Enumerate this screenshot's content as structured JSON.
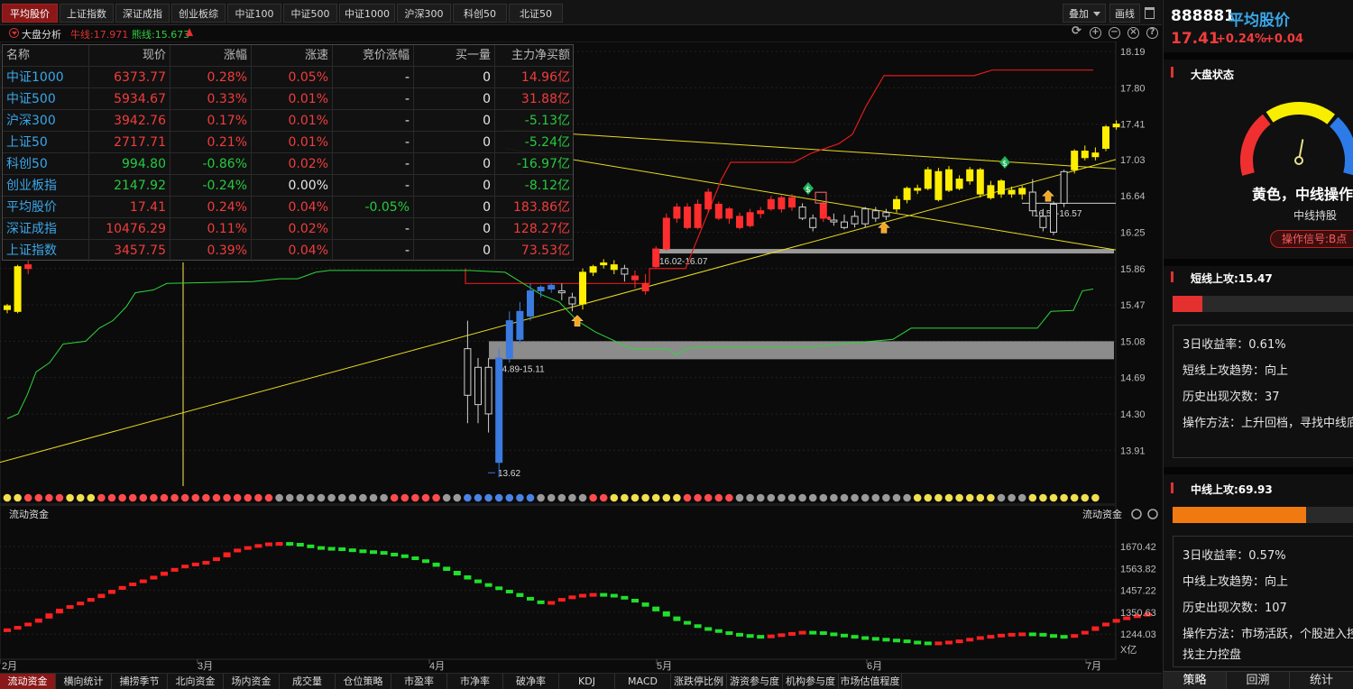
{
  "top_tabs": [
    "平均股价",
    "上证指数",
    "深证成指",
    "创业板综",
    "中证100",
    "中证500",
    "中证1000",
    "沪深300",
    "科创50",
    "北证50"
  ],
  "toolbar": {
    "overlay": "叠加",
    "draw": "画线"
  },
  "subhead": {
    "title": "大盘分析",
    "niu": "牛线:17.971",
    "xiong": "熊线:15.673"
  },
  "main_chart": {
    "y_ticks": [
      "18.19",
      "17.80",
      "17.41",
      "17.03",
      "16.64",
      "16.25",
      "15.86",
      "15.47",
      "15.08",
      "14.69",
      "14.30",
      "13.91"
    ],
    "x_ticks": [
      "2月",
      "3月",
      "4月",
      "5月",
      "6月",
      "7月"
    ],
    "zone_labels": [
      "16.02-16.07",
      "14.89-15.11",
      "16.56-16.57"
    ],
    "low_label": "13.62",
    "colors": {
      "up": "#ff2d2d",
      "down": "#1fe044",
      "yellow": "#ffee00",
      "blue": "#3b7be0",
      "gray": "#cfcfcf"
    }
  },
  "index_table": {
    "headers": [
      "名称",
      "现价",
      "涨幅",
      "涨速",
      "竞价涨幅",
      "买一量",
      "主力净买额"
    ],
    "rows": [
      [
        "中证1000",
        "6373.77",
        "0.28%",
        "0.05%",
        "-",
        "0",
        "14.96亿"
      ],
      [
        "中证500",
        "5934.67",
        "0.33%",
        "0.01%",
        "-",
        "0",
        "31.88亿"
      ],
      [
        "沪深300",
        "3942.76",
        "0.17%",
        "0.01%",
        "-",
        "0",
        "-5.13亿"
      ],
      [
        "上证50",
        "2717.71",
        "0.21%",
        "0.01%",
        "-",
        "0",
        "-5.24亿"
      ],
      [
        "科创50",
        "994.80",
        "-0.86%",
        "0.02%",
        "-",
        "0",
        "-16.97亿"
      ],
      [
        "创业板指",
        "2147.92",
        "-0.24%",
        "0.00%",
        "-",
        "0",
        "-8.12亿"
      ],
      [
        "平均股价",
        "17.41",
        "0.24%",
        "0.04%",
        "-0.05%",
        "0",
        "183.86亿"
      ],
      [
        "深证成指",
        "10476.29",
        "0.11%",
        "0.02%",
        "-",
        "0",
        "128.27亿"
      ],
      [
        "上证指数",
        "3457.75",
        "0.39%",
        "0.04%",
        "-",
        "0",
        "73.53亿"
      ]
    ],
    "row_colors": [
      [
        "blue",
        "red",
        "red",
        "red",
        "white",
        "white",
        "red"
      ],
      [
        "blue",
        "red",
        "red",
        "red",
        "white",
        "white",
        "red"
      ],
      [
        "blue",
        "red",
        "red",
        "red",
        "white",
        "white",
        "green"
      ],
      [
        "blue",
        "red",
        "red",
        "red",
        "white",
        "white",
        "green"
      ],
      [
        "blue",
        "green",
        "green",
        "red",
        "white",
        "white",
        "green"
      ],
      [
        "blue",
        "green",
        "green",
        "white",
        "white",
        "white",
        "green"
      ],
      [
        "blue",
        "red",
        "red",
        "red",
        "green",
        "white",
        "red"
      ],
      [
        "blue",
        "red",
        "red",
        "red",
        "white",
        "white",
        "red"
      ],
      [
        "blue",
        "red",
        "red",
        "red",
        "white",
        "white",
        "red"
      ]
    ]
  },
  "fund_chart": {
    "title": "流动资金",
    "title_right": "流动资金",
    "y_ticks": [
      "1670.42",
      "1563.82",
      "1457.22",
      "1350.63",
      "1244.03"
    ],
    "unit": "X亿"
  },
  "bottom_tabs": [
    "流动资金",
    "横向统计",
    "捕捞季节",
    "北向资金",
    "场内资金",
    "成交量",
    "仓位策略",
    "市盈率",
    "市净率",
    "破净率",
    "KDJ",
    "MACD",
    "涨跌停比例",
    "游资参与度",
    "机构参与度",
    "市场估值程度"
  ],
  "right_panel": {
    "code": "888881",
    "name": "平均股价",
    "price": "17.41",
    "pct": "+0.24%",
    "chg": "+0.04",
    "market_title": "大盘状态",
    "gauge_state": "黄色，中线操作",
    "gauge_sub": "中线持股",
    "signal_btn": "操作信号:B点",
    "gauge_level": 0.55,
    "short": {
      "title": "短线上攻:15.47",
      "bar_pct": 15.47,
      "bar_color": "#e53030",
      "lines": [
        "3日收益率：0.61%",
        "短线上攻趋势：向上",
        "历史出现次数：37",
        "操作方法：上升回档，寻找中线底"
      ]
    },
    "mid": {
      "title": "中线上攻:69.93",
      "bar_pct": 69.93,
      "bar_color": "#f07a10",
      "lines": [
        "3日收益率：0.57%",
        "中线上攻趋势：向上",
        "历史出现次数：107",
        "操作方法：市场活跃，个股进入控",
        "找主力控盘"
      ]
    },
    "tabs": [
      "策略",
      "回溯",
      "统计"
    ]
  }
}
